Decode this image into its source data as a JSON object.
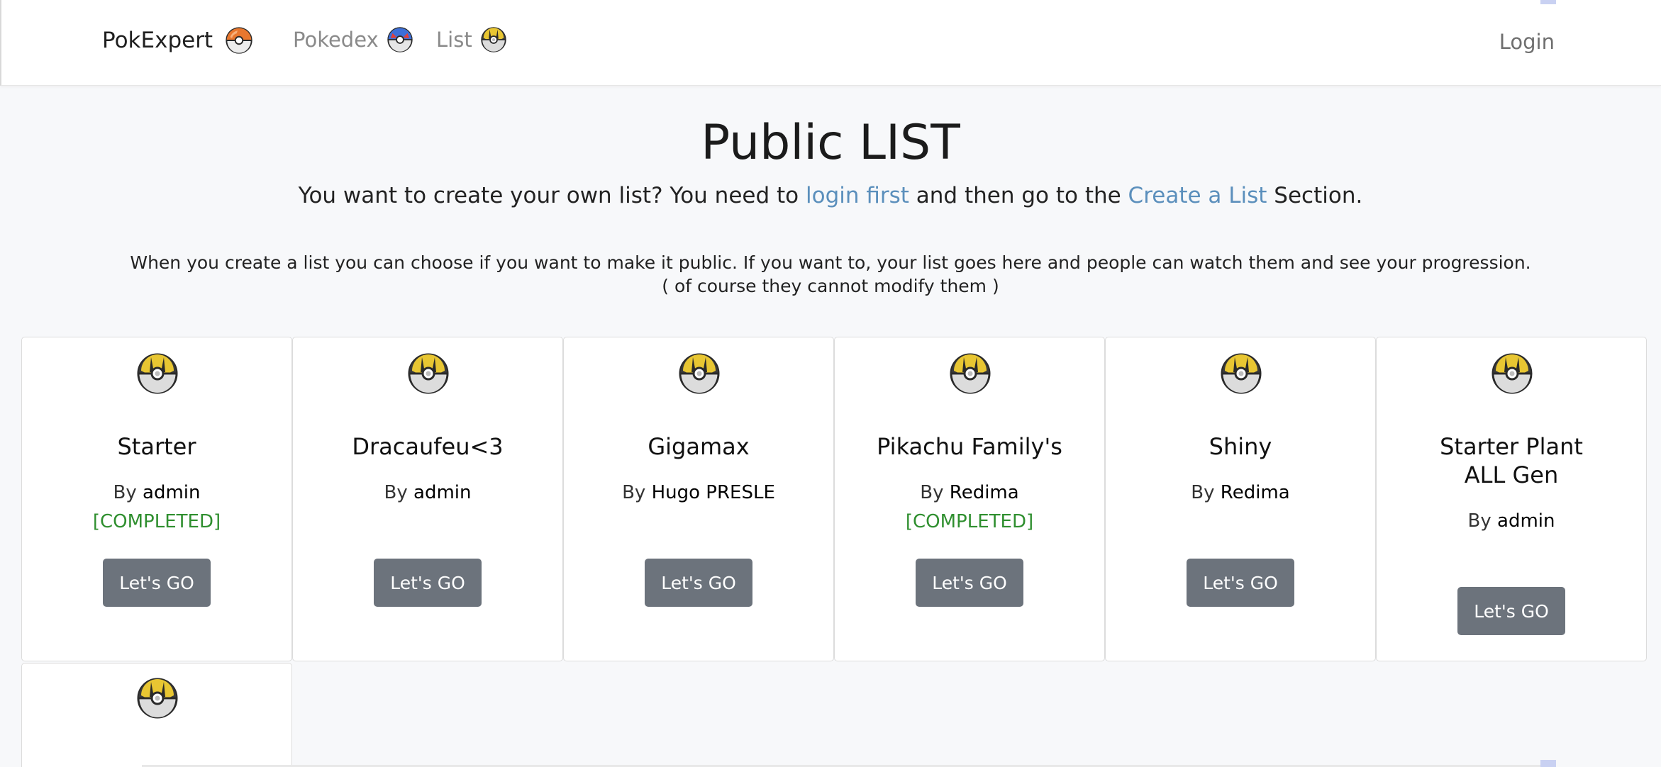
{
  "nav": {
    "brand": "PokExpert",
    "pokedex": "Pokedex",
    "list": "List",
    "login": "Login"
  },
  "icons": {
    "brand": "orange-pokeball-icon",
    "pokedex": "great-ball-icon",
    "list": "ultra-ball-icon",
    "card": "ultra-ball-icon"
  },
  "header": {
    "title": "Public LIST",
    "subtitle_pre": "You want to create your own list? You need to ",
    "login_link": "login first",
    "subtitle_mid": " and then go to the ",
    "create_link": "Create a List",
    "subtitle_post": " Section.",
    "info_line1": "When you create a list you can choose if you want to make it public. If you want to, your list goes here and people can watch them and see your progression.",
    "info_line2": "( of course they cannot modify them )"
  },
  "cards": [
    {
      "name": "Starter",
      "by": "By ",
      "author": "admin",
      "status": "[COMPLETED]",
      "button": "Let's GO"
    },
    {
      "name": "Dracaufeu<3",
      "by": "By ",
      "author": "admin",
      "status": "",
      "button": "Let's GO"
    },
    {
      "name": "Gigamax",
      "by": "By ",
      "author": "Hugo PRESLE",
      "status": "",
      "button": "Let's GO"
    },
    {
      "name": "Pikachu Family's",
      "by": "By ",
      "author": "Redima",
      "status": "[COMPLETED]",
      "button": "Let's GO"
    },
    {
      "name": "Shiny",
      "by": "By ",
      "author": "Redima",
      "status": "",
      "button": "Let's GO"
    },
    {
      "name": "Starter Plant ALL Gen",
      "by": "By ",
      "author": "admin",
      "status": "",
      "button": "Let's GO"
    }
  ],
  "colors": {
    "link": "#5b8fbc",
    "completed": "#2f8f2f",
    "button": "#6c737c",
    "background": "#f7f8fa"
  }
}
